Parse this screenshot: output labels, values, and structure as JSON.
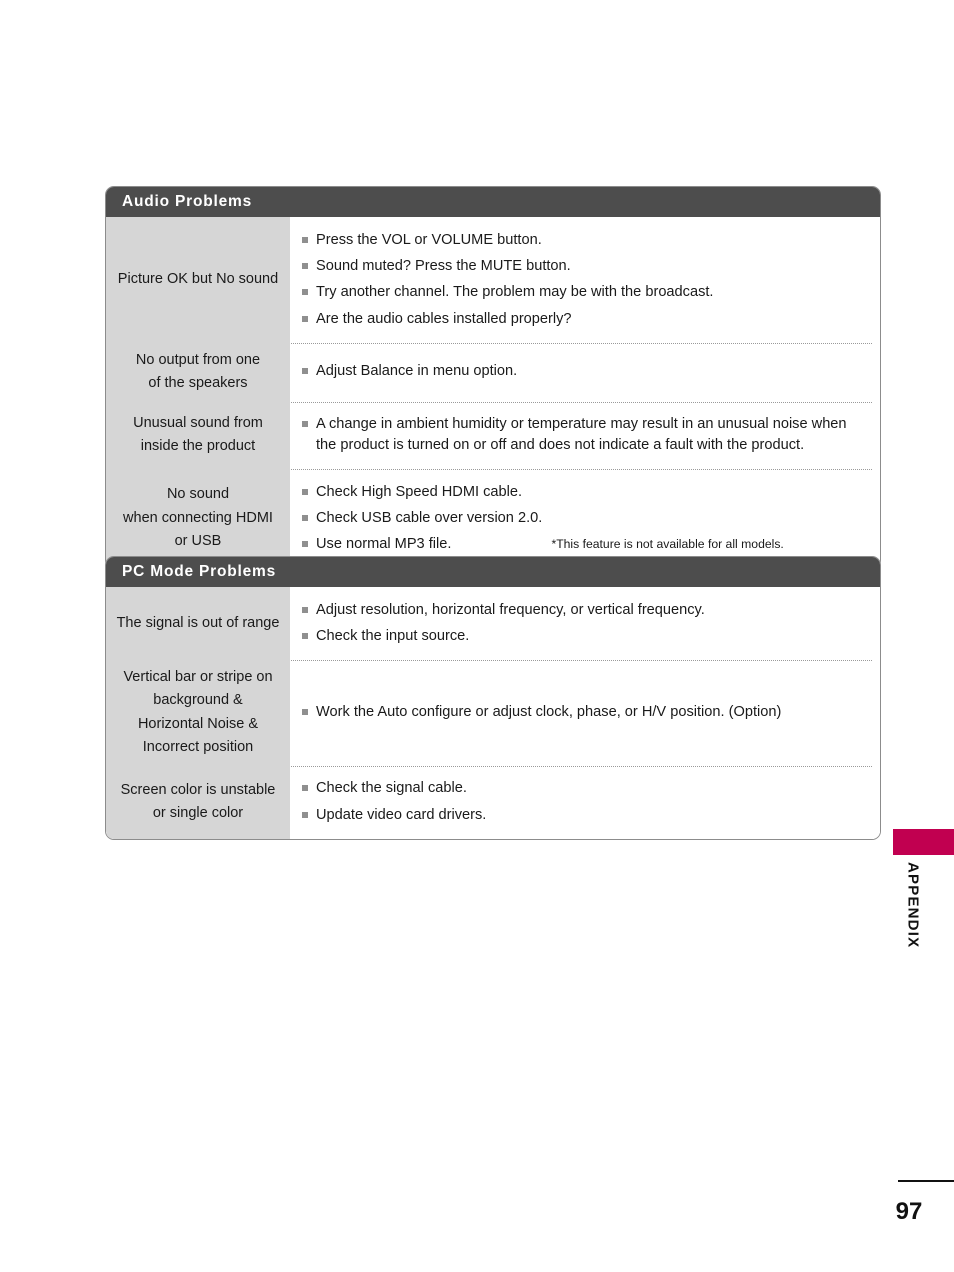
{
  "page": {
    "number": "97",
    "side_tab_label": "APPENDIX",
    "accent_color": "#C10050",
    "header_bar_color": "#4D4D4D",
    "label_cell_color": "#D6D6D6"
  },
  "sections": [
    {
      "id": "audio",
      "title": "Audio Problems",
      "rows": [
        {
          "label": [
            "Picture OK but No sound"
          ],
          "bullets": [
            "Press the VOL or VOLUME button.",
            "Sound muted? Press the MUTE button.",
            "Try another channel. The problem may be with the broadcast.",
            "Are the audio cables installed properly?"
          ]
        },
        {
          "label": [
            "No output from one",
            "of the speakers"
          ],
          "bullets": [
            "Adjust Balance in menu option."
          ]
        },
        {
          "label": [
            "Unusual sound from",
            "inside the product"
          ],
          "bullets": [
            "A change in ambient humidity or temperature may result in an unusual noise when the product is turned on or off and does not indicate a fault with the product."
          ]
        },
        {
          "label": [
            "No sound",
            "when connecting HDMI",
            "or USB"
          ],
          "bullets": [
            "Check High Speed HDMI cable.",
            "Check USB cable over version 2.0.",
            "Use normal MP3 file."
          ],
          "footnote": "*This feature is not available for all models."
        }
      ]
    },
    {
      "id": "pc",
      "title": "PC Mode Problems",
      "rows": [
        {
          "label": [
            "The signal is out of range"
          ],
          "bullets": [
            "Adjust resolution, horizontal frequency, or vertical frequency.",
            "Check the input source."
          ]
        },
        {
          "label": [
            "Vertical bar or stripe on",
            "background &",
            "Horizontal Noise &",
            "Incorrect position"
          ],
          "bullets": [
            "Work the Auto configure or adjust clock, phase, or H/V position. (Option)"
          ]
        },
        {
          "label": [
            "Screen color is unstable",
            "or single color"
          ],
          "bullets": [
            "Check the signal cable.",
            "Update video card drivers."
          ]
        }
      ]
    }
  ]
}
